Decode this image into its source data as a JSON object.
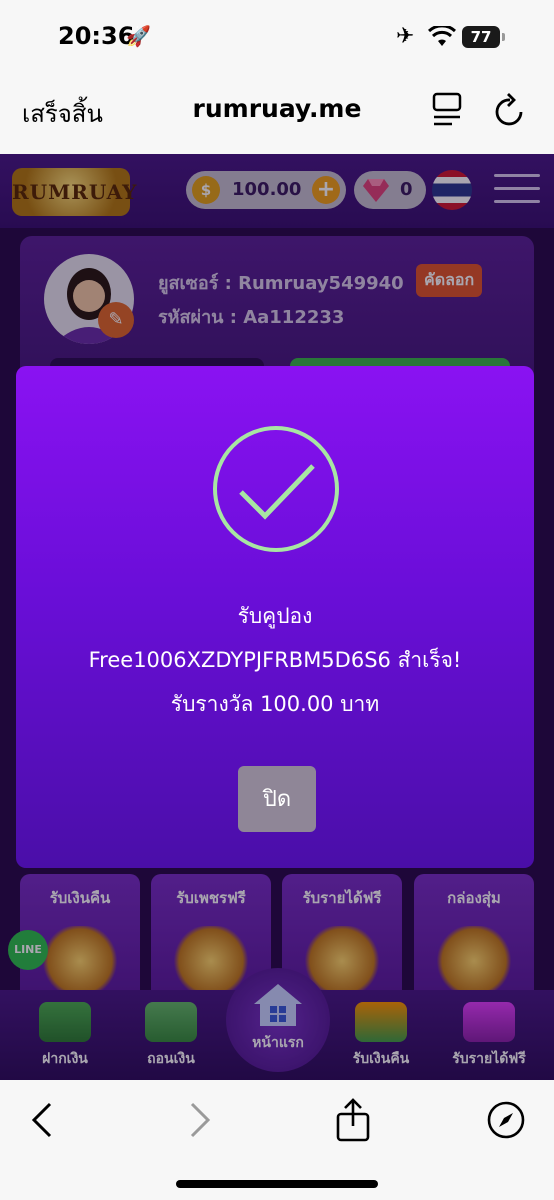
{
  "status_bar": {
    "time": "20:36",
    "battery": "77"
  },
  "safari": {
    "done_label": "เสร็จสิ้น",
    "url": "rumruay.me"
  },
  "site": {
    "logo_text": "RUMRUAY",
    "balance": "100.00",
    "gems": "0",
    "profile": {
      "username_line": "ยูสเซอร์ : Rumruay549940",
      "password_line": "รหัสผ่าน : Aa112233",
      "copy_label": "คัดลอก"
    },
    "features": [
      {
        "label": "รับเงินคืน"
      },
      {
        "label": "รับเพชรฟรี"
      },
      {
        "label": "รับรายได้ฟรี"
      },
      {
        "label": "กล่องสุ่ม"
      }
    ],
    "line_label": "LINE",
    "bottom_nav": {
      "deposit": "ฝากเงิน",
      "withdraw": "ถอนเงิน",
      "home": "หน้าแรก",
      "cashback": "รับเงินคืน",
      "free_income": "รับรายได้ฟรี"
    }
  },
  "modal": {
    "line1": "รับคูปอง",
    "line2": "Free1006XZDYPJFRBM5D6S6  สำเร็จ!",
    "line3": "รับรางวัล 100.00 บาท",
    "close_label": "ปิด",
    "accent_color": "#a8e6a3"
  }
}
